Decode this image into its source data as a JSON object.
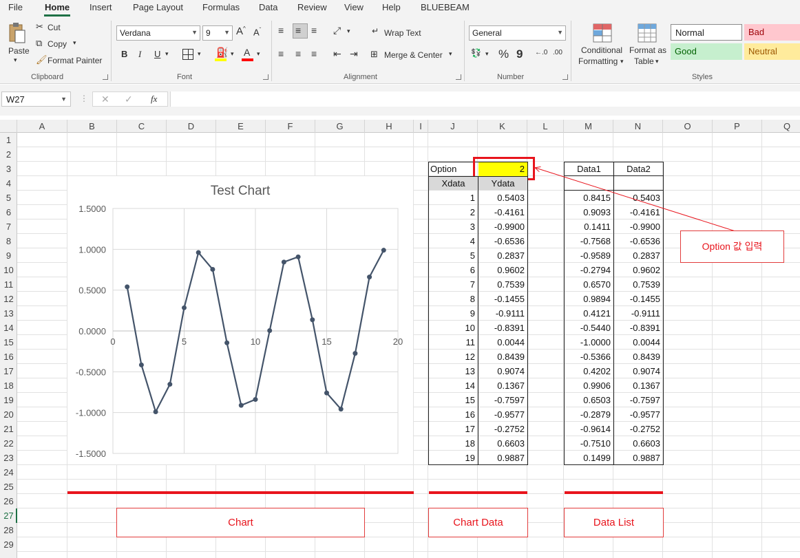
{
  "menu": {
    "tabs": [
      "File",
      "Home",
      "Insert",
      "Page Layout",
      "Formulas",
      "Data",
      "Review",
      "View",
      "Help",
      "BLUEBEAM"
    ],
    "active": "Home"
  },
  "ribbon": {
    "clipboard": {
      "paste": "Paste",
      "cut": "Cut",
      "copy": "Copy",
      "format_painter": "Format Painter",
      "label": "Clipboard"
    },
    "font": {
      "name": "Verdana",
      "size": "9",
      "label": "Font",
      "bold": "B",
      "italic": "I",
      "underline": "U",
      "fill_color": "#ffff00",
      "font_color": "#ff0000"
    },
    "alignment": {
      "wrap_text": "Wrap Text",
      "merge_center": "Merge & Center",
      "label": "Alignment"
    },
    "number": {
      "format": "General",
      "percent": "%",
      "comma": "9",
      "label": "Number"
    },
    "styles": {
      "conditional": "Conditional",
      "formatting": "Formatting",
      "format_as": "Format as",
      "table": "Table",
      "normal": "Normal",
      "bad": "Bad",
      "good": "Good",
      "neutral": "Neutral",
      "label": "Styles"
    }
  },
  "formula_bar": {
    "name_box": "W27",
    "fx": "fx",
    "value": ""
  },
  "grid": {
    "columns": [
      "A",
      "B",
      "C",
      "D",
      "E",
      "F",
      "G",
      "H",
      "I",
      "J",
      "K",
      "L",
      "M",
      "N",
      "O",
      "P",
      "Q"
    ],
    "rows": [
      "1",
      "2",
      "3",
      "4",
      "5",
      "6",
      "7",
      "8",
      "9",
      "10",
      "11",
      "12",
      "13",
      "14",
      "15",
      "16",
      "17",
      "18",
      "19",
      "20",
      "21",
      "22",
      "23",
      "24",
      "25",
      "26",
      "27",
      "28",
      "29"
    ],
    "selected_row": "27"
  },
  "option": {
    "label": "Option",
    "value": "2",
    "highlight": "#ffff00"
  },
  "chart_table": {
    "headers": [
      "Xdata",
      "Ydata"
    ],
    "x": [
      "1",
      "2",
      "3",
      "4",
      "5",
      "6",
      "7",
      "8",
      "9",
      "10",
      "11",
      "12",
      "13",
      "14",
      "15",
      "16",
      "17",
      "18",
      "19"
    ],
    "y": [
      "0.5403",
      "-0.4161",
      "-0.9900",
      "-0.6536",
      "0.2837",
      "0.9602",
      "0.7539",
      "-0.1455",
      "-0.9111",
      "-0.8391",
      "0.0044",
      "0.8439",
      "0.9074",
      "0.1367",
      "-0.7597",
      "-0.9577",
      "-0.2752",
      "0.6603",
      "0.9887"
    ]
  },
  "data_list": {
    "headers": [
      "Data1",
      "Data2"
    ],
    "data1": [
      "0.8415",
      "0.9093",
      "0.1411",
      "-0.7568",
      "-0.9589",
      "-0.2794",
      "0.6570",
      "0.9894",
      "0.4121",
      "-0.5440",
      "-1.0000",
      "-0.5366",
      "0.4202",
      "0.9906",
      "0.6503",
      "-0.2879",
      "-0.9614",
      "-0.7510",
      "0.1499"
    ],
    "data2": [
      "0.5403",
      "-0.4161",
      "-0.9900",
      "-0.6536",
      "0.2837",
      "0.9602",
      "0.7539",
      "-0.1455",
      "-0.9111",
      "-0.8391",
      "0.0044",
      "0.8439",
      "0.9074",
      "0.1367",
      "-0.7597",
      "-0.9577",
      "-0.2752",
      "0.6603",
      "0.9887"
    ]
  },
  "annotations": {
    "callout": "Option 값 입력",
    "chart": "Chart",
    "chart_data": "Chart Data",
    "data_list": "Data List",
    "color": "#e8141c"
  },
  "chart_data": {
    "type": "scatter",
    "title": "Test Chart",
    "x": [
      1,
      2,
      3,
      4,
      5,
      6,
      7,
      8,
      9,
      10,
      11,
      12,
      13,
      14,
      15,
      16,
      17,
      18,
      19
    ],
    "y": [
      0.5403,
      -0.4161,
      -0.99,
      -0.6536,
      0.2837,
      0.9602,
      0.7539,
      -0.1455,
      -0.9111,
      -0.8391,
      0.0044,
      0.8439,
      0.9074,
      0.1367,
      -0.7597,
      -0.9577,
      -0.2752,
      0.6603,
      0.9887
    ],
    "xlim": [
      0,
      20
    ],
    "ylim": [
      -1.5,
      1.5
    ],
    "x_ticks": [
      "0",
      "5",
      "10",
      "15",
      "20"
    ],
    "y_ticks": [
      "1.5000",
      "1.0000",
      "0.5000",
      "0.0000",
      "-0.5000",
      "-1.0000",
      "-1.5000"
    ],
    "grid": true,
    "legend": "none",
    "line_color": "#44546a"
  }
}
